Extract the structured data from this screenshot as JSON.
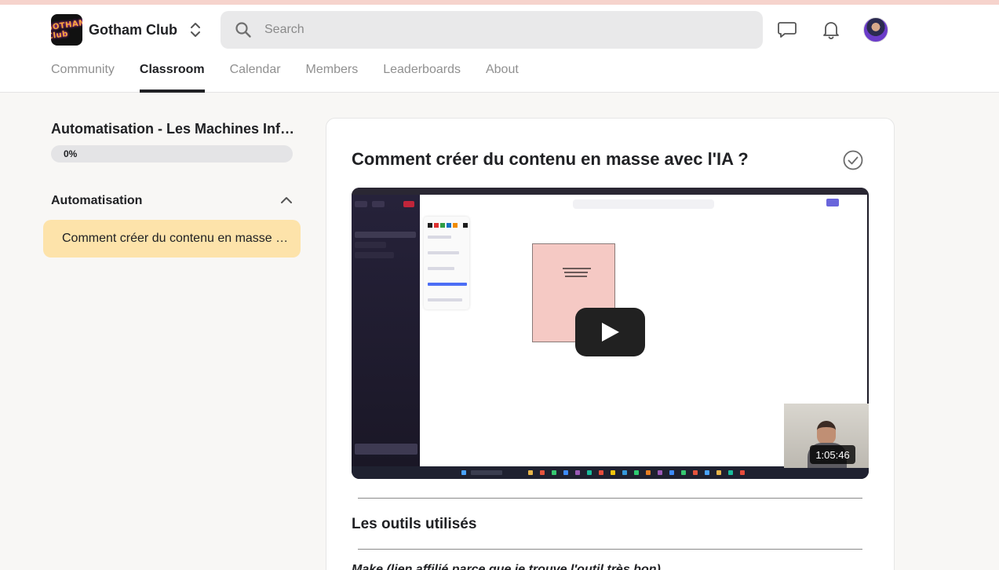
{
  "header": {
    "group_name": "Gotham Club",
    "logo_text": "GOTHAM Club",
    "search_placeholder": "Search"
  },
  "icons": {
    "switch": "chevron-up-down-icon",
    "search": "search-icon",
    "chat": "chat-icon",
    "notifications": "bell-icon",
    "complete": "check-circle-icon",
    "collapse": "chevron-up-icon",
    "play": "play-icon"
  },
  "nav": {
    "tabs": [
      "Community",
      "Classroom",
      "Calendar",
      "Members",
      "Leaderboards",
      "About"
    ],
    "active": "Classroom"
  },
  "course": {
    "title": "Automatisation - Les Machines Infernales",
    "progress_percent": 0,
    "progress_label": "0%"
  },
  "module": {
    "title": "Automatisation",
    "lessons": [
      "Comment créer du contenu en masse avec l'IA ?"
    ]
  },
  "lesson": {
    "title": "Comment créer du contenu en masse avec l'IA ?",
    "video_duration": "1:05:46",
    "section_title": "Les outils utilisés",
    "body_first_line": "Make (lien affilié parce que je trouve l'outil très bon)"
  },
  "colors": {
    "accent_highlight": "#fde3aa",
    "progress_track": "#e4e4e6",
    "top_strip": "#f6d3cc",
    "text_primary": "#202124",
    "text_muted": "#909090"
  }
}
